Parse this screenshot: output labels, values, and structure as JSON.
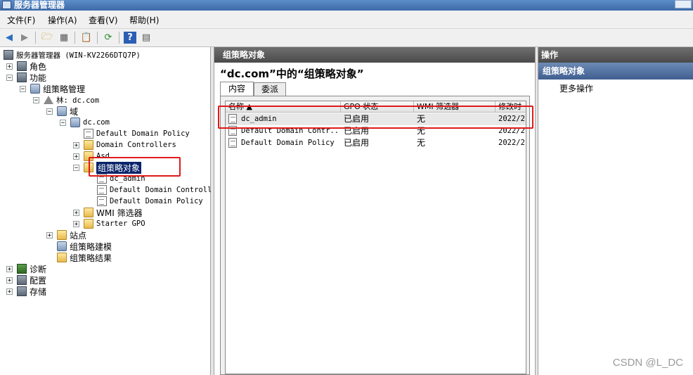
{
  "window": {
    "title": "服务器管理器"
  },
  "menu": [
    "文件(F)",
    "操作(A)",
    "查看(V)",
    "帮助(H)"
  ],
  "toolbar": {
    "icons": [
      "back-arrow-icon",
      "forward-arrow-icon",
      "up-folder-icon",
      "show-hide-tree-icon",
      "properties-icon",
      "refresh-icon",
      "help-icon",
      "show-action-pane-icon"
    ]
  },
  "tree": {
    "root": "服务器管理器 (WIN-KV2266DTQ7P)",
    "roles": "角色",
    "features": "功能",
    "gpm": "组策略管理",
    "forest": "林: dc.com",
    "domains": "域",
    "domain": "dc.com",
    "default_domain_policy": "Default Domain Policy",
    "domain_controllers": "Domain Controllers",
    "ou_asd": "Asd",
    "gpo_container": "组策略对象",
    "gpo_items": [
      "dc_admin",
      "Default Domain Controll",
      "Default Domain Policy"
    ],
    "wmi_filters": "WMI 筛选器",
    "starter_gpo": "Starter GPO",
    "sites": "站点",
    "gp_modeling": "组策略建模",
    "gp_results": "组策略结果",
    "diagnostics": "诊断",
    "configuration": "配置",
    "storage": "存储"
  },
  "center": {
    "header": "组策略对象",
    "heading": "“dc.com”中的“组策略对象”",
    "tabs": [
      "内容",
      "委派"
    ],
    "columns": [
      "名称 ▲",
      "GPO 状态",
      "WMI 筛选器",
      "修改时"
    ],
    "rows": [
      {
        "name": "dc_admin",
        "status": "已启用",
        "wmi": "无",
        "modified": "2022/2"
      },
      {
        "name": "Default Domain Contr...",
        "status": "已启用",
        "wmi": "无",
        "modified": "2022/2"
      },
      {
        "name": "Default Domain Policy",
        "status": "已启用",
        "wmi": "无",
        "modified": "2022/2"
      }
    ]
  },
  "actions": {
    "header": "操作",
    "section": "组策略对象",
    "more": "更多操作"
  },
  "watermark": "CSDN @L_DC"
}
